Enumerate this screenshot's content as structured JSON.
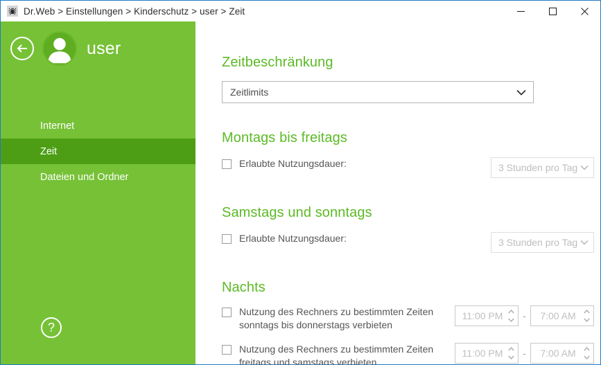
{
  "window": {
    "titlebar_path": "Dr.Web > Einstellungen > Kinderschutz > user > Zeit",
    "app_icon": "spider-icon",
    "border_color": "#1e7bc8",
    "buttons": {
      "minimize": "minimize-icon",
      "maximize": "maximize-icon",
      "close": "close-icon"
    }
  },
  "sidebar": {
    "accent_color": "#76c136",
    "selected_color": "#4d9e15",
    "back_icon": "arrow-left-circle-icon",
    "avatar_icon": "user-avatar-icon",
    "user_name": "user",
    "help_label": "?",
    "items": [
      {
        "label": "Internet",
        "selected": false
      },
      {
        "label": "Zeit",
        "selected": true
      },
      {
        "label": "Dateien und Ordner",
        "selected": false
      }
    ]
  },
  "content": {
    "heading_color": "#5cba25",
    "sections": [
      {
        "title": "Zeitbeschränkung",
        "select": {
          "value": "Zeitlimits",
          "options": [
            "Zeitlimits"
          ],
          "icon": "chevron-down-icon",
          "enabled": true
        }
      },
      {
        "title": "Montags bis freitags",
        "checkbox": {
          "label": "Erlaubte Nutzungsdauer:",
          "checked": false
        },
        "duration": {
          "value": "3 Stunden pro Tag",
          "options": [
            "3 Stunden pro Tag"
          ],
          "icon": "chevron-down-icon",
          "enabled": false
        }
      },
      {
        "title": "Samstags und sonntags",
        "checkbox": {
          "label": "Erlaubte Nutzungsdauer:",
          "checked": false
        },
        "duration": {
          "value": "3 Stunden pro Tag",
          "options": [
            "3 Stunden pro Tag"
          ],
          "icon": "chevron-down-icon",
          "enabled": false
        }
      },
      {
        "title": "Nachts",
        "rows": [
          {
            "label": "Nutzung des Rechners zu bestimmten Zeiten\nsonntags bis donnerstags verbieten",
            "checked": false,
            "time_from": "11:00 PM",
            "time_to": "7:00 AM",
            "separator": "-",
            "enabled": false
          },
          {
            "label": "Nutzung des Rechners zu bestimmten Zeiten\nfreitags und samstags verbieten",
            "checked": false,
            "time_from": "11:00 PM",
            "time_to": "7:00 AM",
            "separator": "-",
            "enabled": false
          }
        ]
      }
    ]
  }
}
